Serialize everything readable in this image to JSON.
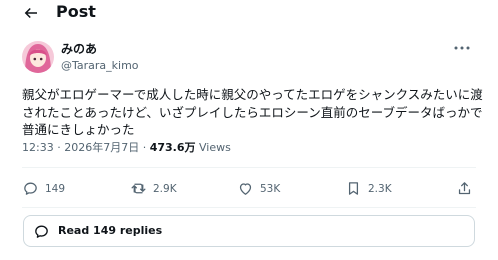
{
  "header": {
    "title": "Post"
  },
  "author": {
    "name": "みのあ",
    "handle": "@Tarara_kimo"
  },
  "post": {
    "lines": [
      "親父がエロゲーマーで成人した時に親父のやってたエロゲをシャンクスみたいに渡",
      "されたことあったけど、いざプレイしたらエロシーン直前のセーブデータばっかで",
      "普通にきしょかった"
    ],
    "time": "12:33",
    "separator": "·",
    "date": "2026年7月7日",
    "views_count": "473.6万",
    "views_label": "Views"
  },
  "stats": {
    "replies": "149",
    "reposts": "2.9K",
    "likes": "53K",
    "bookmarks": "2.3K"
  },
  "read_replies": {
    "label": "Read 149 replies"
  },
  "icons": [
    "back-arrow-icon",
    "more-icon",
    "reply-icon",
    "repost-icon",
    "like-icon",
    "bookmark-icon",
    "share-icon",
    "speech-bubble-icon"
  ]
}
